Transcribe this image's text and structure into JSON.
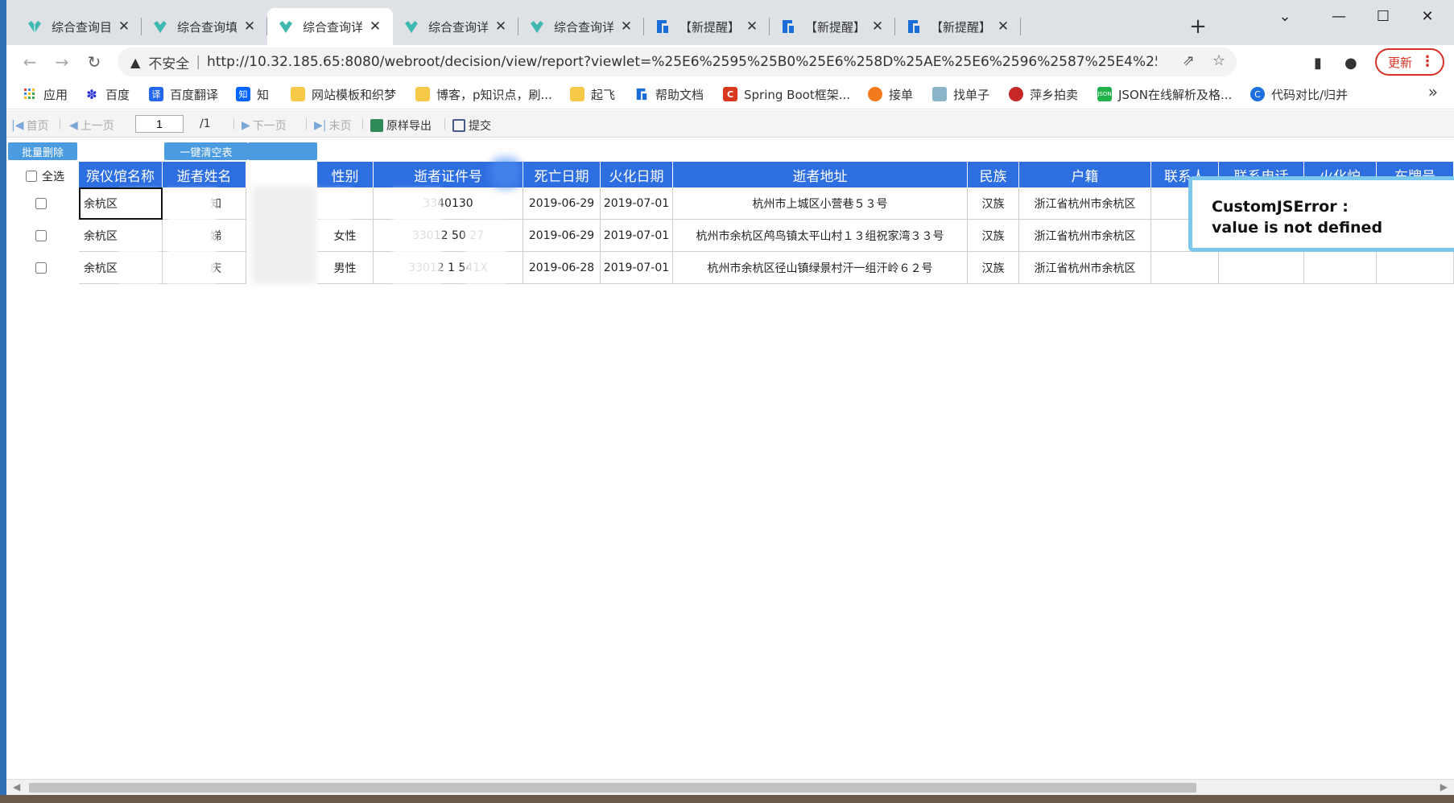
{
  "tabs": [
    {
      "title": "综合查询目录",
      "active": false,
      "icon": "fanruan-icon"
    },
    {
      "title": "综合查询填报",
      "active": false,
      "icon": "fanruan-icon"
    },
    {
      "title": "综合查询详情",
      "active": true,
      "icon": "fanruan-icon"
    },
    {
      "title": "综合查询详情",
      "active": false,
      "icon": "fanruan-icon"
    },
    {
      "title": "综合查询详情",
      "active": false,
      "icon": "fanruan-icon"
    },
    {
      "title": "【新提醒】Cus",
      "active": false,
      "icon": "help-doc-icon"
    },
    {
      "title": "【新提醒】待办",
      "active": false,
      "icon": "help-doc-icon"
    },
    {
      "title": "【新提醒】做个",
      "active": false,
      "icon": "help-doc-icon"
    }
  ],
  "address_bar": {
    "security_label": "不安全",
    "url": "http://10.32.185.65:8080/webroot/decision/view/report?viewlet=%25E6%2595%25B0%25E6%258D%25AE%25E6%2596%2587%25E4%25BB%25B6%..."
  },
  "update_button": "更新",
  "bookmarks": [
    {
      "label": "应用",
      "icon": "apps-grid-icon",
      "color": "#4285f4"
    },
    {
      "label": "百度",
      "icon": "baidu-paw-icon",
      "color": "#2932e1"
    },
    {
      "label": "百度翻译",
      "icon": "baidu-translate-icon",
      "color": "#2468f2",
      "glyph": "译"
    },
    {
      "label": "知",
      "icon": "zhihu-icon",
      "color": "#0066ff",
      "glyph": "知"
    },
    {
      "label": "网站模板和织梦",
      "icon": "folder-icon",
      "color": "#f6c94a"
    },
    {
      "label": "博客，p知识点，刷...",
      "icon": "folder-icon",
      "color": "#f6c94a"
    },
    {
      "label": "起飞",
      "icon": "folder-icon",
      "color": "#f6c94a"
    },
    {
      "label": "帮助文档",
      "icon": "help-doc-icon",
      "color": "#1a6ed8"
    },
    {
      "label": "Spring Boot框架...",
      "icon": "csdn-icon",
      "color": "#d9381e",
      "glyph": "C"
    },
    {
      "label": "接单",
      "icon": "jiedan-icon",
      "color": "#f37b1d"
    },
    {
      "label": "找单子",
      "icon": "zhaodanzi-icon",
      "color": "#8ab4c8"
    },
    {
      "label": "萍乡拍卖",
      "icon": "auction-icon",
      "color": "#c62828"
    },
    {
      "label": "JSON在线解析及格...",
      "icon": "json-icon",
      "color": "#21b24b"
    },
    {
      "label": "代码对比/归并",
      "icon": "code-compare-icon",
      "color": "#1e6fe0"
    }
  ],
  "report_toolbar": {
    "first": "首页",
    "prev": "上一页",
    "page_current": "1",
    "page_total": "/1",
    "next": "下一页",
    "last": "末页",
    "export": "原样导出",
    "submit": "提交"
  },
  "actions": {
    "batch_delete": "批量删除",
    "clear_table": "一键清空表",
    "select_all": "全选"
  },
  "table": {
    "headers": [
      "殡仪馆名称",
      "逝者姓名",
      "性别",
      "逝者证件号",
      "死亡日期",
      "火化日期",
      "逝者地址",
      "民族",
      "户籍",
      "联系人",
      "联系电话",
      "火化炉",
      "车牌号"
    ],
    "rows": [
      {
        "funeral_home": "余杭区",
        "name": "知",
        "gender": "",
        "id_number": "3340130",
        "death_date": "2019-06-29",
        "cremation_date": "2019-07-01",
        "address": "杭州市上城区小营巷５３号",
        "ethnicity": "汉族",
        "household": "浙江省杭州市余杭区"
      },
      {
        "funeral_home": "余杭区",
        "name": "娣",
        "gender": "女性",
        "id_number": "33012  50   27",
        "death_date": "2019-06-29",
        "cremation_date": "2019-07-01",
        "address": "杭州市余杭区鸬鸟镇太平山村１３组祝家湾３３号",
        "ethnicity": "汉族",
        "household": "浙江省杭州市余杭区"
      },
      {
        "funeral_home": "余杭区",
        "name": "庆",
        "gender": "男性",
        "id_number": "33012   1   541X",
        "death_date": "2019-06-28",
        "cremation_date": "2019-07-01",
        "address": "杭州市余杭区径山镇绿景村汗一组汗岭６２号",
        "ethnicity": "汉族",
        "household": "浙江省杭州市余杭区"
      }
    ]
  },
  "error_popup": {
    "title": "CustomJSError :",
    "message": "value is not defined"
  },
  "colors": {
    "header_blue": "#2d6ee0",
    "button_blue": "#4a9be0",
    "error_border": "#7cc7ee",
    "update_red": "#d93025"
  }
}
